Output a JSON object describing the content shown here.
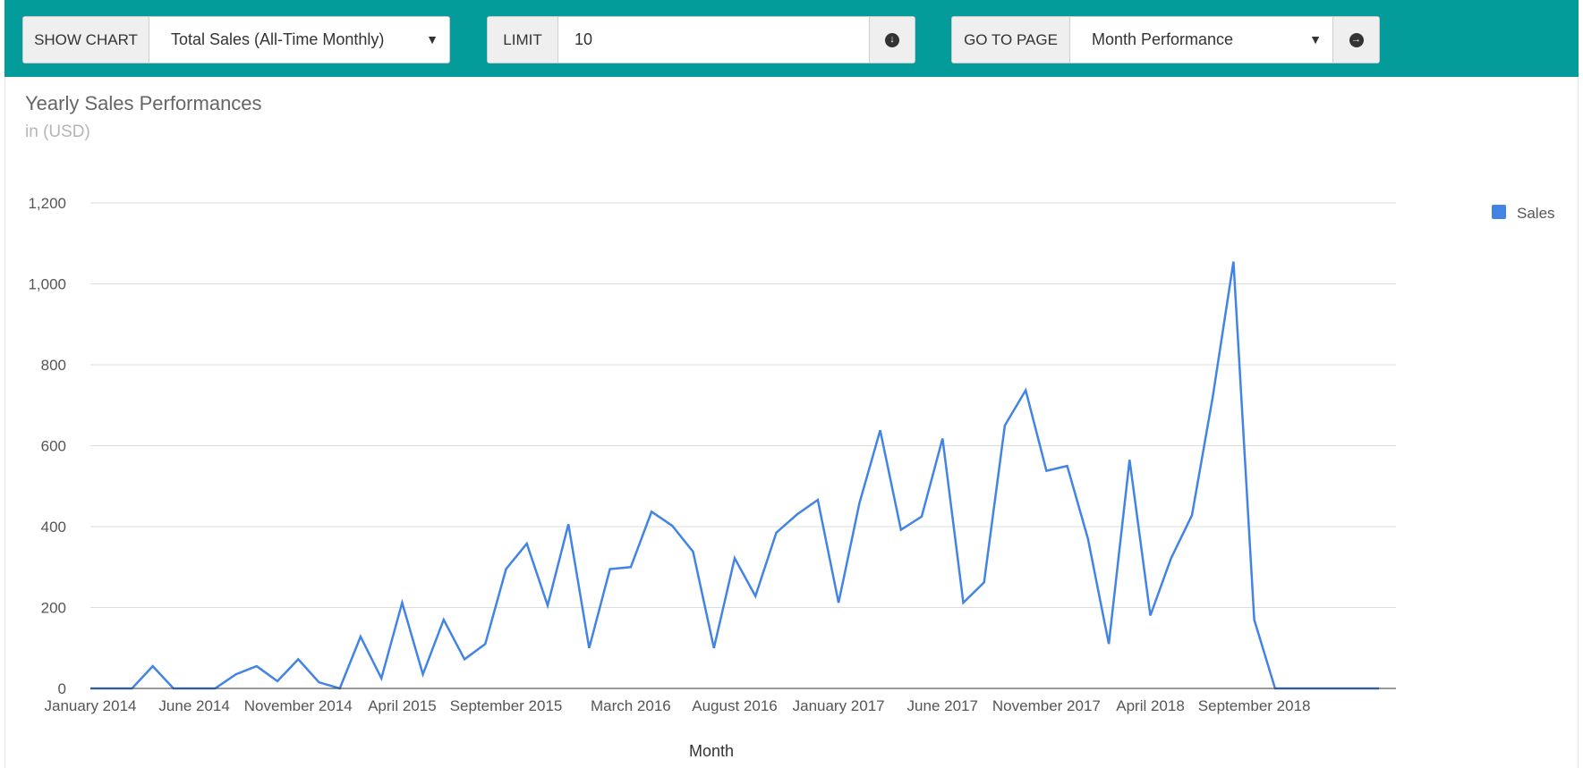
{
  "toolbar": {
    "show_chart_label": "SHOW CHART",
    "show_chart_value": "Total Sales (All-Time Monthly)",
    "limit_label": "LIMIT",
    "limit_value": "10",
    "goto_label": "GO TO PAGE",
    "goto_value": "Month Performance",
    "background": "#049b9b"
  },
  "icons": {
    "limit_submit": "circle-arrow-down-icon",
    "goto_submit": "circle-arrow-right-icon",
    "dropdown": "caret-down-icon"
  },
  "chart_data": {
    "type": "line",
    "title": "Yearly Sales Performances",
    "subtitle": "in (USD)",
    "xlabel": "Month",
    "ylabel": "",
    "ylim": [
      0,
      1200
    ],
    "yticks": [
      0,
      200,
      400,
      600,
      800,
      1000,
      1200
    ],
    "ytick_labels": [
      "0",
      "200",
      "400",
      "600",
      "800",
      "1,000",
      "1,200"
    ],
    "grid": true,
    "legend": {
      "position": "right",
      "entries": [
        "Sales"
      ]
    },
    "x": [
      "January 2014",
      "February 2014",
      "March 2014",
      "April 2014",
      "May 2014",
      "June 2014",
      "July 2014",
      "August 2014",
      "September 2014",
      "October 2014",
      "November 2014",
      "December 2014",
      "January 2015",
      "February 2015",
      "March 2015",
      "April 2015",
      "May 2015",
      "June 2015",
      "July 2015",
      "August 2015",
      "September 2015",
      "October 2015",
      "November 2015",
      "December 2015",
      "January 2016",
      "February 2016",
      "March 2016",
      "April 2016",
      "May 2016",
      "June 2016",
      "July 2016",
      "August 2016",
      "September 2016",
      "October 2016",
      "November 2016",
      "December 2016",
      "January 2017",
      "February 2017",
      "March 2017",
      "April 2017",
      "May 2017",
      "June 2017",
      "July 2017",
      "August 2017",
      "September 2017",
      "October 2017",
      "November 2017",
      "December 2017",
      "January 2018",
      "February 2018",
      "March 2018",
      "April 2018",
      "May 2018",
      "June 2018",
      "July 2018",
      "August 2018",
      "September 2018",
      "October 2018",
      "November 2018",
      "December 2018",
      "January 2019",
      "February 2019",
      "March 2019"
    ],
    "x_tick_labels": [
      "January 2014",
      "June 2014",
      "November 2014",
      "April 2015",
      "September 2015",
      "March 2016",
      "August 2016",
      "January 2017",
      "June 2017",
      "November 2017",
      "April 2018",
      "September 2018"
    ],
    "x_tick_indices": [
      0,
      5,
      10,
      15,
      20,
      26,
      31,
      36,
      41,
      46,
      51,
      56
    ],
    "series": [
      {
        "name": "Sales",
        "color": "#4184e4",
        "values": [
          0,
          0,
          0,
          55,
          0,
          0,
          0,
          35,
          55,
          18,
          72,
          15,
          0,
          128,
          25,
          212,
          35,
          170,
          72,
          110,
          295,
          358,
          205,
          406,
          100,
          295,
          300,
          437,
          402,
          338,
          100,
          322,
          228,
          385,
          430,
          466,
          212,
          458,
          638,
          392,
          425,
          618,
          212,
          262,
          650,
          737,
          538,
          550,
          370,
          110,
          565,
          180,
          322,
          428,
          720,
          1055,
          170,
          0,
          0,
          0,
          0,
          0,
          0
        ]
      }
    ]
  }
}
